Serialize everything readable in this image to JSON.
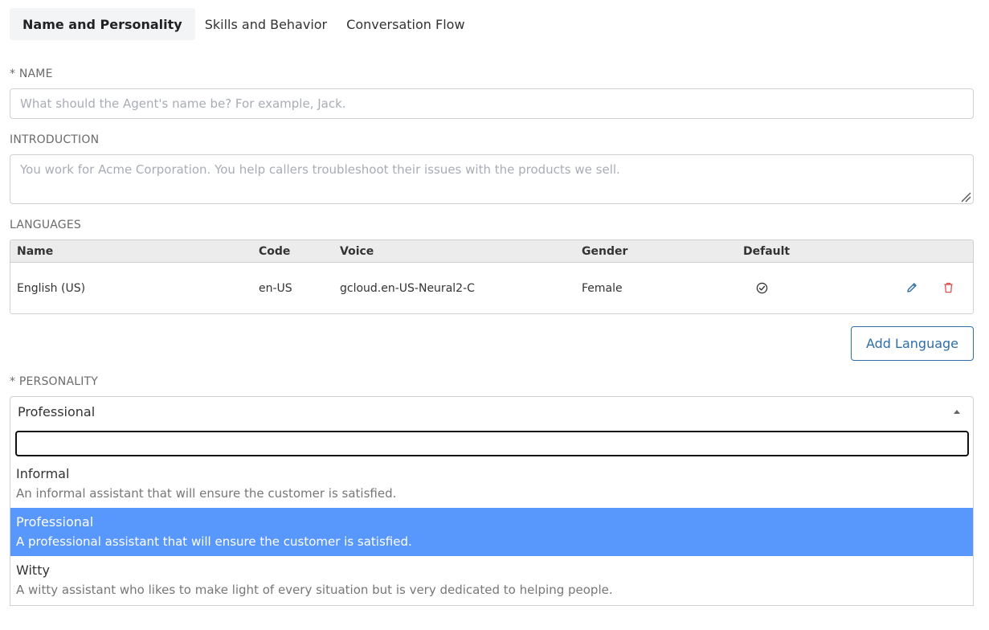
{
  "tabs": [
    {
      "label": "Name and Personality",
      "active": true
    },
    {
      "label": "Skills and Behavior",
      "active": false
    },
    {
      "label": "Conversation Flow",
      "active": false
    }
  ],
  "name": {
    "label": "* NAME",
    "value": "",
    "placeholder": "What should the Agent's name be? For example, Jack."
  },
  "introduction": {
    "label": "INTRODUCTION",
    "value": "",
    "placeholder": "You work for Acme Corporation. You help callers troubleshoot their issues with the products we sell."
  },
  "languages": {
    "label": "LANGUAGES",
    "columns": [
      "Name",
      "Code",
      "Voice",
      "Gender",
      "Default"
    ],
    "rows": [
      {
        "name": "English (US)",
        "code": "en-US",
        "voice": "gcloud.en-US-Neural2-C",
        "gender": "Female",
        "default": true
      }
    ],
    "add_label": "Add Language"
  },
  "personality": {
    "label": "* PERSONALITY",
    "selected": "Professional",
    "search_value": "",
    "options": [
      {
        "title": "Informal",
        "description": "An informal assistant that will ensure the customer is satisfied.",
        "selected": false
      },
      {
        "title": "Professional",
        "description": "A professional assistant that will ensure the customer is satisfied.",
        "selected": true
      },
      {
        "title": "Witty",
        "description": "A witty assistant who likes to make light of every situation but is very dedicated to helping people.",
        "selected": false
      }
    ]
  },
  "colors": {
    "accent": "#2f6ea8",
    "selected_option": "#5897fb",
    "delete": "#d9534f"
  },
  "icons": {
    "edit": "pencil-icon",
    "delete": "trash-icon",
    "default": "check-circle-icon",
    "dropdown": "caret-up-icon"
  }
}
